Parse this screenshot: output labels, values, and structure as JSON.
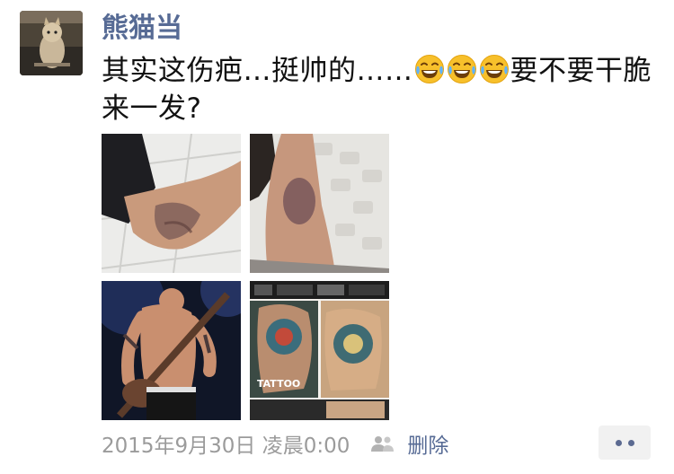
{
  "post": {
    "username": "熊猫当",
    "text_before": "其实这伤疤…挺帅的……",
    "emojis": [
      "tears-of-joy-icon",
      "tears-of-joy-icon",
      "tears-of-joy-icon"
    ],
    "text_after": "要不要干脆来一发?",
    "images": [
      {
        "name": "photo-elbow-scar-1"
      },
      {
        "name": "photo-elbow-scar-2"
      },
      {
        "name": "photo-guitarist-tattoo"
      },
      {
        "name": "photo-tattoo-collage",
        "caption": "TATTOO"
      }
    ],
    "timestamp": "2015年9月30日 凌晨0:00",
    "delete_label": "删除",
    "more_icon": "more-dots-icon"
  },
  "colors": {
    "name_blue": "#576b95",
    "text": "#111111",
    "meta_gray": "#9b9b9b"
  }
}
